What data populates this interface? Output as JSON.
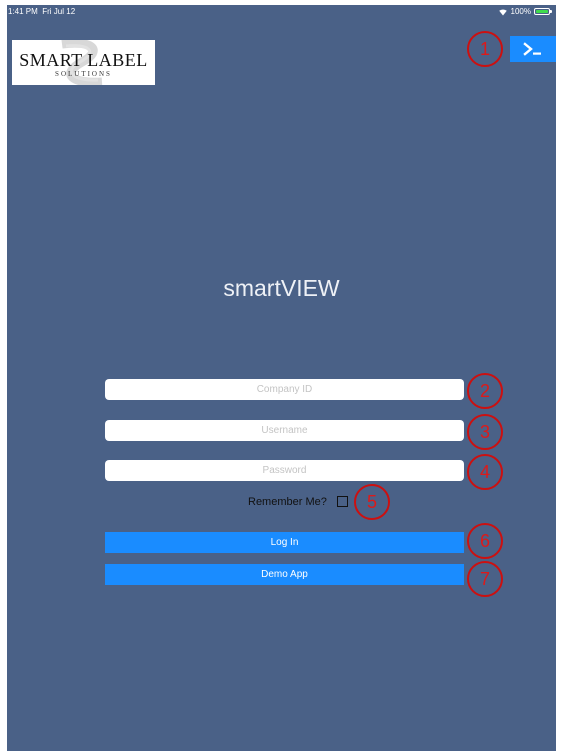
{
  "status_bar": {
    "time": "1:41 PM",
    "date": "Fri Jul 12",
    "battery": "100%",
    "battery_level": 1.0
  },
  "logo": {
    "title": "SMART LABEL",
    "subtitle": "SOLUTIONS"
  },
  "toolbar": {
    "terminal_icon": "terminal-icon"
  },
  "app": {
    "title": "smartVIEW"
  },
  "login_form": {
    "company_id_placeholder": "Company ID",
    "username_placeholder": "Username",
    "password_placeholder": "Password",
    "remember_me_label": "Remember Me?",
    "remember_me_checked": false,
    "login_label": "Log In",
    "demo_label": "Demo App"
  },
  "annotations": [
    "1",
    "2",
    "3",
    "4",
    "5",
    "6",
    "7"
  ],
  "colors": {
    "background": "#4a6187",
    "accent": "#1a8cff",
    "annotation": "#cc1010"
  }
}
